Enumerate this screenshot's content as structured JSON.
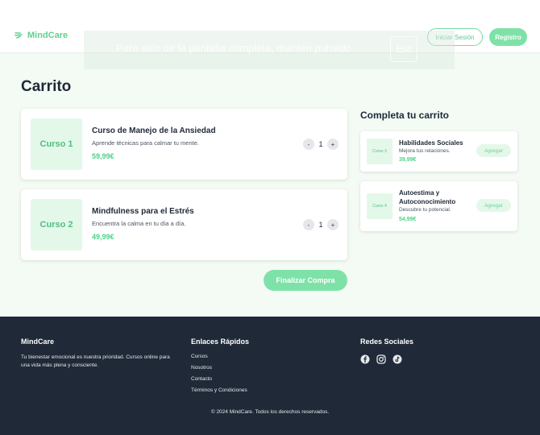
{
  "header": {
    "brand": "MindCare",
    "login_label": "Iniciar Sesión",
    "register_label": "Registro",
    "fullscreen_notice": "Para salir de la pantalla completa, mantén pulsado",
    "fullscreen_key": "Esc"
  },
  "cart": {
    "title": "Carrito",
    "items": [
      {
        "thumb": "Curso 1",
        "name": "Curso de Manejo de la Ansiedad",
        "description": "Aprende técnicas para calmar tu mente.",
        "price": "59,99€",
        "quantity": "1"
      },
      {
        "thumb": "Curso 2",
        "name": "Mindfulness para el Estrés",
        "description": "Encuentra la calma en tu día a día.",
        "price": "49,99€",
        "quantity": "1"
      }
    ],
    "minus": "-",
    "plus": "+",
    "checkout_label": "Finalizar Compra"
  },
  "suggestions": {
    "title": "Completa tu carrito",
    "items": [
      {
        "thumb": "Curso 3",
        "name": "Habilidades Sociales",
        "description": "Mejora tus relaciones.",
        "price": "39,99€",
        "add_label": "Agregar"
      },
      {
        "thumb": "Curso 4",
        "name": "Autoestima y Autoconocimiento",
        "description": "Descubre tu potencial.",
        "price": "54,99€",
        "add_label": "Agregar"
      }
    ]
  },
  "footer": {
    "brand": "MindCare",
    "about": "Tu bienestar emocional es nuestra prioridad. Cursos online para una vida más plena y consciente.",
    "links_title": "Enlaces Rápidos",
    "links": [
      "Cursos",
      "Nosotros",
      "Contacto",
      "Términos y Condiciones"
    ],
    "social_title": "Redes Sociales",
    "social_icons": [
      "facebook-icon",
      "instagram-icon",
      "tiktok-icon"
    ],
    "copyright": "© 2024 MindCare. Todos los derechos reservados."
  },
  "colors": {
    "accent": "#7ee2a8",
    "accent_text": "#4fd18a",
    "thumb_bg": "#e4f8ea",
    "footer_bg": "#1f2937",
    "page_bg": "#f3fbf4"
  }
}
